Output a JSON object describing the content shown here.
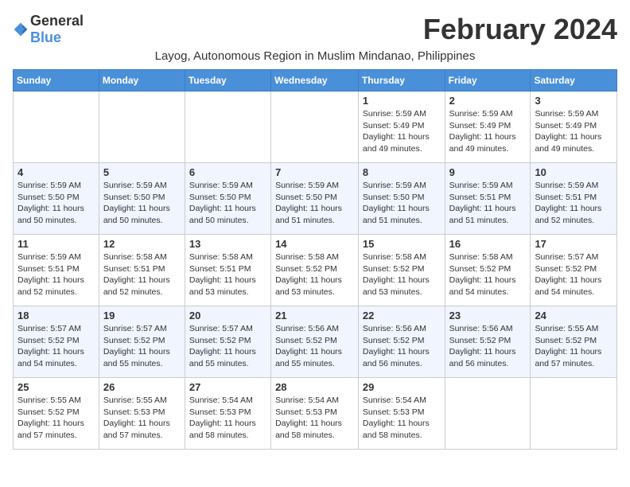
{
  "header": {
    "logo_general": "General",
    "logo_blue": "Blue",
    "month": "February 2024",
    "location": "Layog, Autonomous Region in Muslim Mindanao, Philippines"
  },
  "weekdays": [
    "Sunday",
    "Monday",
    "Tuesday",
    "Wednesday",
    "Thursday",
    "Friday",
    "Saturday"
  ],
  "weeks": [
    [
      {
        "day": "",
        "info": ""
      },
      {
        "day": "",
        "info": ""
      },
      {
        "day": "",
        "info": ""
      },
      {
        "day": "",
        "info": ""
      },
      {
        "day": "1",
        "info": "Sunrise: 5:59 AM\nSunset: 5:49 PM\nDaylight: 11 hours\nand 49 minutes."
      },
      {
        "day": "2",
        "info": "Sunrise: 5:59 AM\nSunset: 5:49 PM\nDaylight: 11 hours\nand 49 minutes."
      },
      {
        "day": "3",
        "info": "Sunrise: 5:59 AM\nSunset: 5:49 PM\nDaylight: 11 hours\nand 49 minutes."
      }
    ],
    [
      {
        "day": "4",
        "info": "Sunrise: 5:59 AM\nSunset: 5:50 PM\nDaylight: 11 hours\nand 50 minutes."
      },
      {
        "day": "5",
        "info": "Sunrise: 5:59 AM\nSunset: 5:50 PM\nDaylight: 11 hours\nand 50 minutes."
      },
      {
        "day": "6",
        "info": "Sunrise: 5:59 AM\nSunset: 5:50 PM\nDaylight: 11 hours\nand 50 minutes."
      },
      {
        "day": "7",
        "info": "Sunrise: 5:59 AM\nSunset: 5:50 PM\nDaylight: 11 hours\nand 51 minutes."
      },
      {
        "day": "8",
        "info": "Sunrise: 5:59 AM\nSunset: 5:50 PM\nDaylight: 11 hours\nand 51 minutes."
      },
      {
        "day": "9",
        "info": "Sunrise: 5:59 AM\nSunset: 5:51 PM\nDaylight: 11 hours\nand 51 minutes."
      },
      {
        "day": "10",
        "info": "Sunrise: 5:59 AM\nSunset: 5:51 PM\nDaylight: 11 hours\nand 52 minutes."
      }
    ],
    [
      {
        "day": "11",
        "info": "Sunrise: 5:59 AM\nSunset: 5:51 PM\nDaylight: 11 hours\nand 52 minutes."
      },
      {
        "day": "12",
        "info": "Sunrise: 5:58 AM\nSunset: 5:51 PM\nDaylight: 11 hours\nand 52 minutes."
      },
      {
        "day": "13",
        "info": "Sunrise: 5:58 AM\nSunset: 5:51 PM\nDaylight: 11 hours\nand 53 minutes."
      },
      {
        "day": "14",
        "info": "Sunrise: 5:58 AM\nSunset: 5:52 PM\nDaylight: 11 hours\nand 53 minutes."
      },
      {
        "day": "15",
        "info": "Sunrise: 5:58 AM\nSunset: 5:52 PM\nDaylight: 11 hours\nand 53 minutes."
      },
      {
        "day": "16",
        "info": "Sunrise: 5:58 AM\nSunset: 5:52 PM\nDaylight: 11 hours\nand 54 minutes."
      },
      {
        "day": "17",
        "info": "Sunrise: 5:57 AM\nSunset: 5:52 PM\nDaylight: 11 hours\nand 54 minutes."
      }
    ],
    [
      {
        "day": "18",
        "info": "Sunrise: 5:57 AM\nSunset: 5:52 PM\nDaylight: 11 hours\nand 54 minutes."
      },
      {
        "day": "19",
        "info": "Sunrise: 5:57 AM\nSunset: 5:52 PM\nDaylight: 11 hours\nand 55 minutes."
      },
      {
        "day": "20",
        "info": "Sunrise: 5:57 AM\nSunset: 5:52 PM\nDaylight: 11 hours\nand 55 minutes."
      },
      {
        "day": "21",
        "info": "Sunrise: 5:56 AM\nSunset: 5:52 PM\nDaylight: 11 hours\nand 55 minutes."
      },
      {
        "day": "22",
        "info": "Sunrise: 5:56 AM\nSunset: 5:52 PM\nDaylight: 11 hours\nand 56 minutes."
      },
      {
        "day": "23",
        "info": "Sunrise: 5:56 AM\nSunset: 5:52 PM\nDaylight: 11 hours\nand 56 minutes."
      },
      {
        "day": "24",
        "info": "Sunrise: 5:55 AM\nSunset: 5:52 PM\nDaylight: 11 hours\nand 57 minutes."
      }
    ],
    [
      {
        "day": "25",
        "info": "Sunrise: 5:55 AM\nSunset: 5:52 PM\nDaylight: 11 hours\nand 57 minutes."
      },
      {
        "day": "26",
        "info": "Sunrise: 5:55 AM\nSunset: 5:53 PM\nDaylight: 11 hours\nand 57 minutes."
      },
      {
        "day": "27",
        "info": "Sunrise: 5:54 AM\nSunset: 5:53 PM\nDaylight: 11 hours\nand 58 minutes."
      },
      {
        "day": "28",
        "info": "Sunrise: 5:54 AM\nSunset: 5:53 PM\nDaylight: 11 hours\nand 58 minutes."
      },
      {
        "day": "29",
        "info": "Sunrise: 5:54 AM\nSunset: 5:53 PM\nDaylight: 11 hours\nand 58 minutes."
      },
      {
        "day": "",
        "info": ""
      },
      {
        "day": "",
        "info": ""
      }
    ]
  ]
}
